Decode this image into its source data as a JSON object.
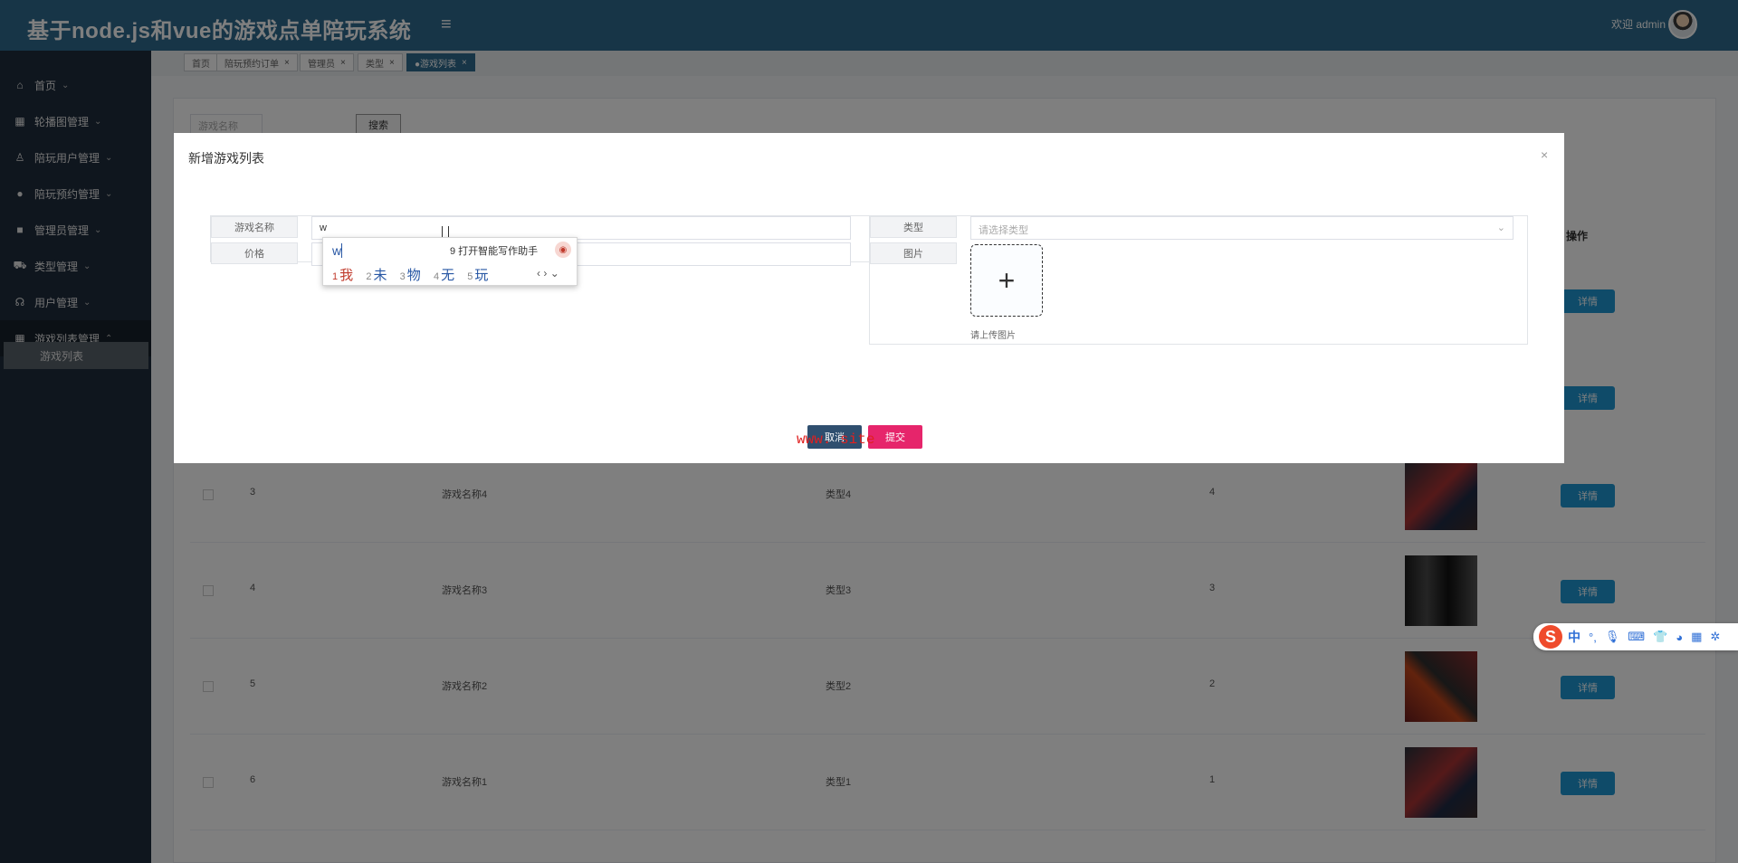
{
  "header": {
    "title": "基于node.js和vue的游戏点单陪玩系统",
    "menu_icon": "≡",
    "welcome": "欢迎 admin"
  },
  "sidebar": {
    "items": [
      {
        "label": "首页",
        "icon": "home-icon"
      },
      {
        "label": "轮播图管理",
        "icon": "image-icon"
      },
      {
        "label": "陪玩用户管理",
        "icon": "user-icon"
      },
      {
        "label": "陪玩预约管理",
        "icon": "calendar-icon"
      },
      {
        "label": "管理员管理",
        "icon": "admin-icon"
      },
      {
        "label": "类型管理",
        "icon": "category-icon"
      },
      {
        "label": "用户管理",
        "icon": "users-icon"
      },
      {
        "label": "游戏列表管理",
        "icon": "game-list-icon"
      }
    ],
    "sub_item": "游戏列表"
  },
  "tabs": [
    {
      "label": "首页"
    },
    {
      "label": "陪玩预约订单"
    },
    {
      "label": "管理员"
    },
    {
      "label": "类型"
    },
    {
      "label": "●游戏列表",
      "active": true
    }
  ],
  "search": {
    "placeholder": "游戏名称",
    "button": "搜索"
  },
  "table": {
    "op_header": "操作",
    "detail_label": "详情",
    "rows": [
      {
        "index": "3",
        "name": "游戏名称4",
        "type": "类型4",
        "price": "4"
      },
      {
        "index": "4",
        "name": "游戏名称3",
        "type": "类型3",
        "price": "3"
      },
      {
        "index": "5",
        "name": "游戏名称2",
        "type": "类型2",
        "price": "2"
      },
      {
        "index": "6",
        "name": "游戏名称1",
        "type": "类型1",
        "price": "1"
      }
    ]
  },
  "dialog": {
    "title": "新增游戏列表",
    "close": "×",
    "labels": {
      "game_name": "游戏名称",
      "price": "价格",
      "type": "类型",
      "image": "图片"
    },
    "game_name_value": "w",
    "type_placeholder": "请选择类型",
    "upload_hint": "请上传图片",
    "cancel": "取消",
    "submit": "提交"
  },
  "ime_popup": {
    "pinyin": "w",
    "assist": "9 打开智能写作助手",
    "candidates": [
      {
        "n": "1",
        "c": "我"
      },
      {
        "n": "2",
        "c": "未"
      },
      {
        "n": "3",
        "c": "物"
      },
      {
        "n": "4",
        "c": "无"
      },
      {
        "n": "5",
        "c": "玩"
      }
    ]
  },
  "ime_bar": {
    "logo": "S",
    "lang": "中"
  },
  "watermark": "www.       site",
  "colors": {
    "header": "#2f6b8e",
    "sidebar": "#1f2d3d",
    "detail_button": "#1e96d3",
    "cancel_button": "#2f4f6f",
    "submit_button": "#e6256b"
  }
}
